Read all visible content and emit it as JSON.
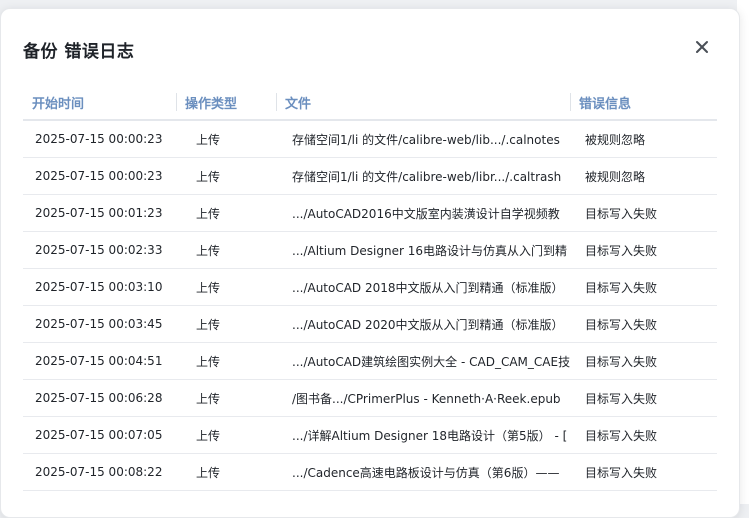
{
  "modal": {
    "title": "备份 错误日志",
    "close_icon": "close-icon"
  },
  "table": {
    "headers": [
      "开始时间",
      "操作类型",
      "文件",
      "错误信息"
    ],
    "rows": [
      {
        "time": "2025-07-15 00:00:23",
        "type": "上传",
        "file": "存储空间1/li 的文件/calibre-web/lib.../.calnotes",
        "error": "被规则忽略"
      },
      {
        "time": "2025-07-15 00:00:23",
        "type": "上传",
        "file": "存储空间1/li 的文件/calibre-web/libr.../.caltrash",
        "error": "被规则忽略"
      },
      {
        "time": "2025-07-15 00:01:23",
        "type": "上传",
        "file": ".../AutoCAD2016中文版室内装潢设计自学视频教",
        "error": "目标写入失败"
      },
      {
        "time": "2025-07-15 00:02:33",
        "type": "上传",
        "file": ".../Altium Designer 16电路设计与仿真从入门到精",
        "error": "目标写入失败"
      },
      {
        "time": "2025-07-15 00:03:10",
        "type": "上传",
        "file": ".../AutoCAD 2018中文版从入门到精通（标准版）",
        "error": "目标写入失败"
      },
      {
        "time": "2025-07-15 00:03:45",
        "type": "上传",
        "file": ".../AutoCAD 2020中文版从入门到精通（标准版）",
        "error": "目标写入失败"
      },
      {
        "time": "2025-07-15 00:04:51",
        "type": "上传",
        "file": ".../AutoCAD建筑绘图实例大全 - CAD_CAM_CAE技",
        "error": "目标写入失败"
      },
      {
        "time": "2025-07-15 00:06:28",
        "type": "上传",
        "file": "/图书备.../CPrimerPlus - Kenneth·A·Reek.epub",
        "error": "目标写入失败"
      },
      {
        "time": "2025-07-15 00:07:05",
        "type": "上传",
        "file": ".../详解Altium Designer 18电路设计（第5版） - [",
        "error": "目标写入失败"
      },
      {
        "time": "2025-07-15 00:08:22",
        "type": "上传",
        "file": ".../Cadence高速电路板设计与仿真（第6版）——",
        "error": "目标写入失败"
      }
    ]
  }
}
